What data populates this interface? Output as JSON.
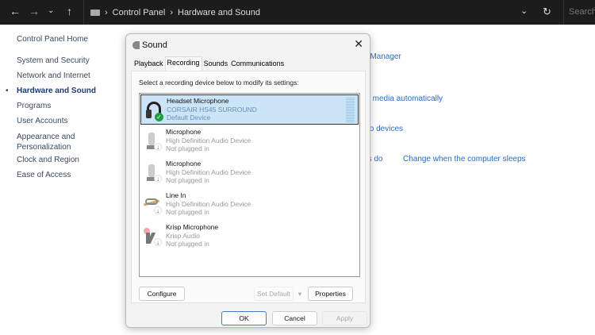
{
  "explorer": {
    "breadcrumb": [
      "Control Panel",
      "Hardware and Sound"
    ],
    "search_placeholder": "Search C"
  },
  "sidebar": {
    "home": "Control Panel Home",
    "items": [
      "System and Security",
      "Network and Internet",
      "Hardware and Sound",
      "Programs",
      "User Accounts",
      "Appearance and Personalization",
      "Clock and Region",
      "Ease of Access"
    ],
    "active": "Hardware and Sound"
  },
  "background_links": [
    "e Manager",
    "er media automatically",
    "dio devices",
    "ns do",
    "Change when the computer sleeps"
  ],
  "dialog": {
    "title": "Sound",
    "tabs": [
      "Playback",
      "Recording",
      "Sounds",
      "Communications"
    ],
    "active_tab": "Recording",
    "instruction": "Select a recording device below to modify its settings:",
    "devices": [
      {
        "name": "Headset Microphone",
        "driver": "CORSAIR HS45 SURROUND",
        "status": "Default Device",
        "icon": "headset-icon",
        "selected": true
      },
      {
        "name": "Microphone",
        "driver": "High Definition Audio Device",
        "status": "Not plugged in",
        "icon": "microphone-icon"
      },
      {
        "name": "Microphone",
        "driver": "High Definition Audio Device",
        "status": "Not plugged in",
        "icon": "microphone-icon"
      },
      {
        "name": "Line In",
        "driver": "High Definition Audio Device",
        "status": "Not plugged in",
        "icon": "line-in-icon"
      },
      {
        "name": "Krisp Microphone",
        "driver": "Krisp Audio",
        "status": "Not plugged in",
        "icon": "krisp-icon"
      }
    ],
    "buttons": {
      "configure": "Configure",
      "set_default": "Set Default",
      "properties": "Properties",
      "ok": "OK",
      "cancel": "Cancel",
      "apply": "Apply"
    }
  },
  "colors": {
    "link": "#2a6dc4",
    "selection": "#cce4f7",
    "default_check": "#1e9e3e",
    "unplugged": "#d42a2a"
  }
}
